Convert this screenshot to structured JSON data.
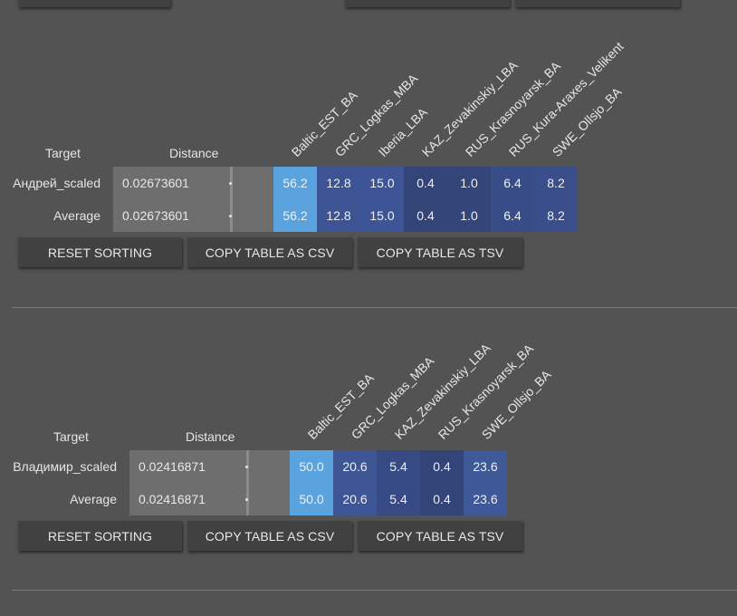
{
  "top_partial": {},
  "colors": {
    "background": "#535353",
    "button_bg": "#414141",
    "distance_cell": "#6e6e6e",
    "value_high": "#5aa3df",
    "value_mid": "#3e5595",
    "value_low": "#334478"
  },
  "tables": [
    {
      "headers": {
        "target": "Target",
        "distance": "Distance"
      },
      "columns": [
        "Baltic_EST_BA",
        "GRC_Logkas_MBA",
        "Iberia_LBA",
        "KAZ_Zevakinskiy_LBA",
        "RUS_Krasnoyarsk_BA",
        "RUS_Kura-Araxes_Velikent",
        "SWE_Ollsjo_BA"
      ],
      "rows": [
        {
          "target": "Андрей_scaled",
          "distance": "0.02673601",
          "values": [
            "56.2",
            "12.8",
            "15.0",
            "0.4",
            "1.0",
            "6.4",
            "8.2"
          ]
        },
        {
          "target": "Average",
          "distance": "0.02673601",
          "values": [
            "56.2",
            "12.8",
            "15.0",
            "0.4",
            "1.0",
            "6.4",
            "8.2"
          ]
        }
      ],
      "buttons": {
        "reset": "RESET SORTING",
        "csv": "COPY TABLE AS CSV",
        "tsv": "COPY TABLE AS TSV"
      }
    },
    {
      "headers": {
        "target": "Target",
        "distance": "Distance"
      },
      "columns": [
        "Baltic_EST_BA",
        "GRC_Logkas_MBA",
        "KAZ_Zevakinskiy_LBA",
        "RUS_Krasnoyarsk_BA",
        "SWE_Ollsjo_BA"
      ],
      "rows": [
        {
          "target": "Владимир_scaled",
          "distance": "0.02416871",
          "values": [
            "50.0",
            "20.6",
            "5.4",
            "0.4",
            "23.6"
          ]
        },
        {
          "target": "Average",
          "distance": "0.02416871",
          "values": [
            "50.0",
            "20.6",
            "5.4",
            "0.4",
            "23.6"
          ]
        }
      ],
      "buttons": {
        "reset": "RESET SORTING",
        "csv": "COPY TABLE AS CSV",
        "tsv": "COPY TABLE AS TSV"
      }
    }
  ]
}
